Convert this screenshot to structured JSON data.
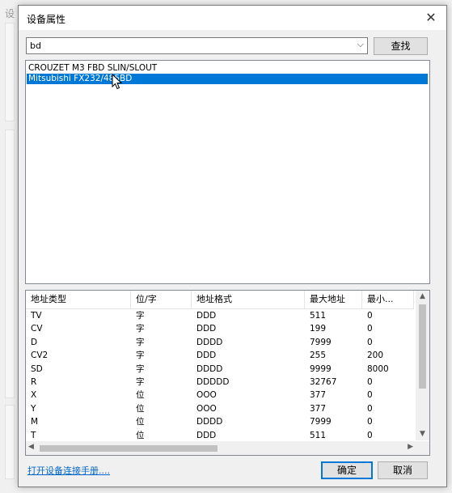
{
  "background": {
    "title": "设"
  },
  "dialog": {
    "title": "设备属性",
    "close_glyph": "✕"
  },
  "search": {
    "value": "bd",
    "dropdown_glyph": "⌵",
    "find_label": "查找"
  },
  "device_list": [
    "CROUZET M3 FBD SLIN/SLOUT",
    "Mitsubishi FX232/485BD"
  ],
  "selected_device_index": 1,
  "table": {
    "headers": [
      "地址类型",
      "位/字",
      "地址格式",
      "最大地址",
      "最小..."
    ],
    "rows": [
      [
        "TV",
        "字",
        "DDD",
        "511",
        "0"
      ],
      [
        "CV",
        "字",
        "DDD",
        "199",
        "0"
      ],
      [
        "D",
        "字",
        "DDDD",
        "7999",
        "0"
      ],
      [
        "CV2",
        "字",
        "DDD",
        "255",
        "200"
      ],
      [
        "SD",
        "字",
        "DDDD",
        "9999",
        "8000"
      ],
      [
        "R",
        "字",
        "DDDDD",
        "32767",
        "0"
      ],
      [
        "X",
        "位",
        "OOO",
        "377",
        "0"
      ],
      [
        "Y",
        "位",
        "OOO",
        "377",
        "0"
      ],
      [
        "M",
        "位",
        "DDDD",
        "7999",
        "0"
      ],
      [
        "T",
        "位",
        "DDD",
        "511",
        "0"
      ]
    ],
    "scroll_glyphs": {
      "up": "▲",
      "down": "▼",
      "left": "◀",
      "right": "▶"
    }
  },
  "footer": {
    "manual_link": "打开设备连接手册....",
    "ok_label": "确定",
    "cancel_label": "取消"
  },
  "colors": {
    "selection": "#0078d7",
    "link": "#0066cc",
    "default_button_border": "#0078d7"
  }
}
